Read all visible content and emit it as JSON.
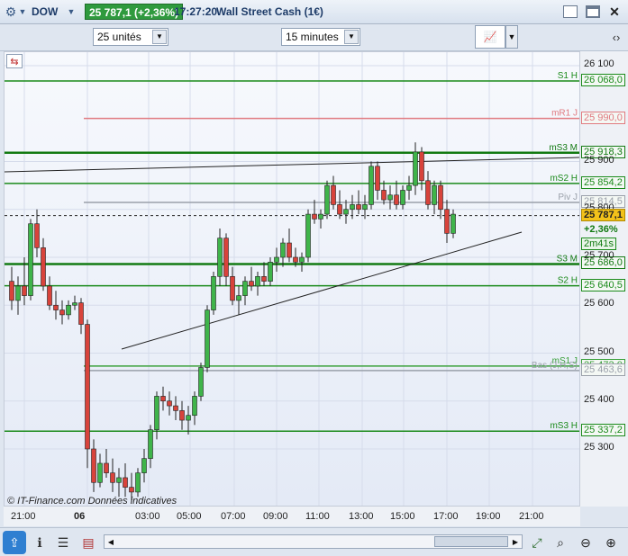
{
  "titlebar": {
    "symbol": "DOW",
    "price_badge": "25 787,1 (+2,36%)",
    "time": "17:27:20",
    "instrument": "Wall Street Cash (1€)"
  },
  "toolbar": {
    "units_select": "25 unités",
    "interval_select": "15 minutes"
  },
  "chart": {
    "watermark": "© IT-Finance.com Données indicatives",
    "trend_label": "Bas (J,H,S)",
    "levels": [
      {
        "name": "S1 H",
        "value": "26 068,0",
        "color": "#1a8a1a",
        "price": 26068
      },
      {
        "name": "mR1 J",
        "value": "25 990,0",
        "color": "#e07a80",
        "price": 25990
      },
      {
        "name": "mS3 M",
        "value": "25 918,3",
        "color": "#127a12",
        "price": 25918.3
      },
      {
        "name": "mS2 H",
        "value": "25 854,2",
        "color": "#1a8a1a",
        "price": 25854.2
      },
      {
        "name": "Piv J",
        "value": "25 814,5",
        "color": "#9aa0aa",
        "price": 25814.5
      },
      {
        "name": "S3 M",
        "value": "25 686,0",
        "color": "#127a12",
        "price": 25686
      },
      {
        "name": "S2 H",
        "value": "25 640,5",
        "color": "#1a8a1a",
        "price": 25640.5
      },
      {
        "name": "mS1 J",
        "value": "25 473,0",
        "color": "#3aa03a",
        "price": 25473
      },
      {
        "name": "",
        "value": "25 463,6",
        "color": "#9aa0aa",
        "price": 25463.6
      },
      {
        "name": "mS3 H",
        "value": "25 337,2",
        "color": "#1a8a1a",
        "price": 25337.2
      }
    ],
    "current": {
      "value": "25 787,1",
      "change": "+2,36%",
      "countdown": "2m41s"
    },
    "price_ticks": [
      "26 100",
      "25 900",
      "25 800",
      "25 700",
      "25 600",
      "25 500",
      "25 400",
      "25 300"
    ],
    "time_ticks": [
      "21:00",
      "06",
      "03:00",
      "05:00",
      "07:00",
      "09:00",
      "11:00",
      "13:00",
      "15:00",
      "17:00",
      "19:00",
      "21:00"
    ]
  },
  "candles": [
    [
      25650,
      25680,
      25590,
      25610
    ],
    [
      25610,
      25660,
      25580,
      25640
    ],
    [
      25640,
      25700,
      25600,
      25620
    ],
    [
      25620,
      25780,
      25610,
      25770
    ],
    [
      25770,
      25800,
      25700,
      25720
    ],
    [
      25720,
      25740,
      25630,
      25640
    ],
    [
      25640,
      25660,
      25590,
      25600
    ],
    [
      25600,
      25630,
      25570,
      25590
    ],
    [
      25590,
      25610,
      25560,
      25580
    ],
    [
      25580,
      25610,
      25570,
      25600
    ],
    [
      25600,
      25620,
      25590,
      25605
    ],
    [
      25605,
      25615,
      25540,
      25560
    ],
    [
      25560,
      25570,
      25260,
      25300
    ],
    [
      25300,
      25320,
      25210,
      25230
    ],
    [
      25230,
      25290,
      25220,
      25270
    ],
    [
      25270,
      25300,
      25240,
      25250
    ],
    [
      25250,
      25280,
      25210,
      25230
    ],
    [
      25230,
      25260,
      25200,
      25240
    ],
    [
      25240,
      25270,
      25200,
      25220
    ],
    [
      25220,
      25250,
      25190,
      25210
    ],
    [
      25210,
      25260,
      25200,
      25250
    ],
    [
      25250,
      25300,
      25230,
      25280
    ],
    [
      25280,
      25350,
      25260,
      25340
    ],
    [
      25340,
      25420,
      25320,
      25410
    ],
    [
      25410,
      25430,
      25380,
      25400
    ],
    [
      25400,
      25420,
      25370,
      25390
    ],
    [
      25390,
      25410,
      25360,
      25380
    ],
    [
      25380,
      25400,
      25340,
      25360
    ],
    [
      25360,
      25390,
      25330,
      25370
    ],
    [
      25370,
      25420,
      25350,
      25410
    ],
    [
      25410,
      25480,
      25400,
      25470
    ],
    [
      25470,
      25600,
      25460,
      25590
    ],
    [
      25590,
      25670,
      25580,
      25660
    ],
    [
      25660,
      25760,
      25640,
      25740
    ],
    [
      25740,
      25750,
      25640,
      25660
    ],
    [
      25660,
      25680,
      25600,
      25610
    ],
    [
      25610,
      25640,
      25580,
      25620
    ],
    [
      25620,
      25660,
      25600,
      25650
    ],
    [
      25650,
      25680,
      25630,
      25640
    ],
    [
      25640,
      25670,
      25620,
      25660
    ],
    [
      25660,
      25690,
      25640,
      25650
    ],
    [
      25650,
      25700,
      25640,
      25690
    ],
    [
      25690,
      25720,
      25670,
      25700
    ],
    [
      25700,
      25740,
      25680,
      25730
    ],
    [
      25730,
      25760,
      25690,
      25700
    ],
    [
      25700,
      25720,
      25680,
      25690
    ],
    [
      25690,
      25710,
      25670,
      25700
    ],
    [
      25700,
      25800,
      25690,
      25790
    ],
    [
      25790,
      25820,
      25770,
      25780
    ],
    [
      25780,
      25800,
      25760,
      25790
    ],
    [
      25790,
      25860,
      25780,
      25850
    ],
    [
      25850,
      25870,
      25800,
      25810
    ],
    [
      25810,
      25840,
      25780,
      25790
    ],
    [
      25790,
      25820,
      25770,
      25800
    ],
    [
      25800,
      25830,
      25780,
      25810
    ],
    [
      25810,
      25840,
      25790,
      25800
    ],
    [
      25800,
      25830,
      25780,
      25810
    ],
    [
      25810,
      25900,
      25800,
      25890
    ],
    [
      25890,
      25900,
      25820,
      25840
    ],
    [
      25840,
      25860,
      25810,
      25820
    ],
    [
      25820,
      25850,
      25800,
      25830
    ],
    [
      25830,
      25860,
      25800,
      25810
    ],
    [
      25810,
      25850,
      25800,
      25840
    ],
    [
      25840,
      25870,
      25820,
      25850
    ],
    [
      25850,
      25940,
      25830,
      25920
    ],
    [
      25920,
      25930,
      25840,
      25860
    ],
    [
      25860,
      25880,
      25800,
      25810
    ],
    [
      25810,
      25860,
      25790,
      25850
    ],
    [
      25850,
      25860,
      25780,
      25800
    ],
    [
      25800,
      25820,
      25730,
      25750
    ],
    [
      25750,
      25800,
      25740,
      25790
    ]
  ]
}
